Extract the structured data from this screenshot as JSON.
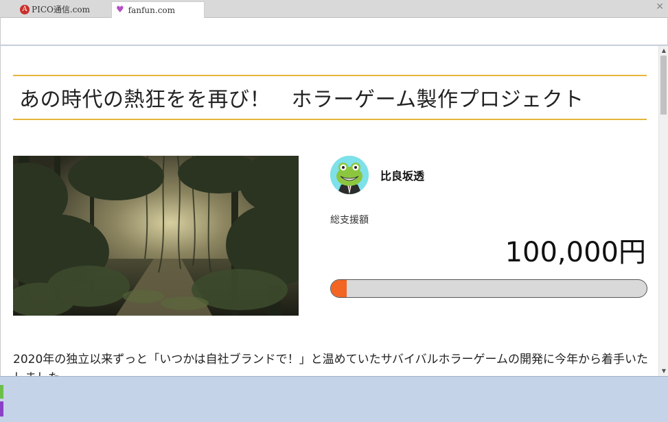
{
  "browser": {
    "tabs": [
      {
        "label": "PICO通信.com",
        "favicon": "a-circle-icon",
        "active": false
      },
      {
        "label": "fanfun.com",
        "favicon": "heart-icon",
        "active": true
      }
    ],
    "close_glyph": "✕",
    "tab_a_glyph": "A",
    "tab_heart_glyph": "♥"
  },
  "page": {
    "title": "あの時代の熱狂をを再び！　ホラーゲーム製作プロジェクト",
    "creator_name": "比良坂透",
    "total_label": "総支援額",
    "total_amount": "100,000円",
    "progress_fraction": 0.05,
    "body_text": "2020年の独立以来ずっと「いつかは自社ブランドで！」と温めていたサバイバルホラーゲームの開発に今年から着手いたしました。"
  },
  "colors": {
    "accent_line": "#e6b43a",
    "progress_fill": "#f26522",
    "progress_track": "#d9d9d9",
    "avatar_bg": "#7ee0e8"
  }
}
